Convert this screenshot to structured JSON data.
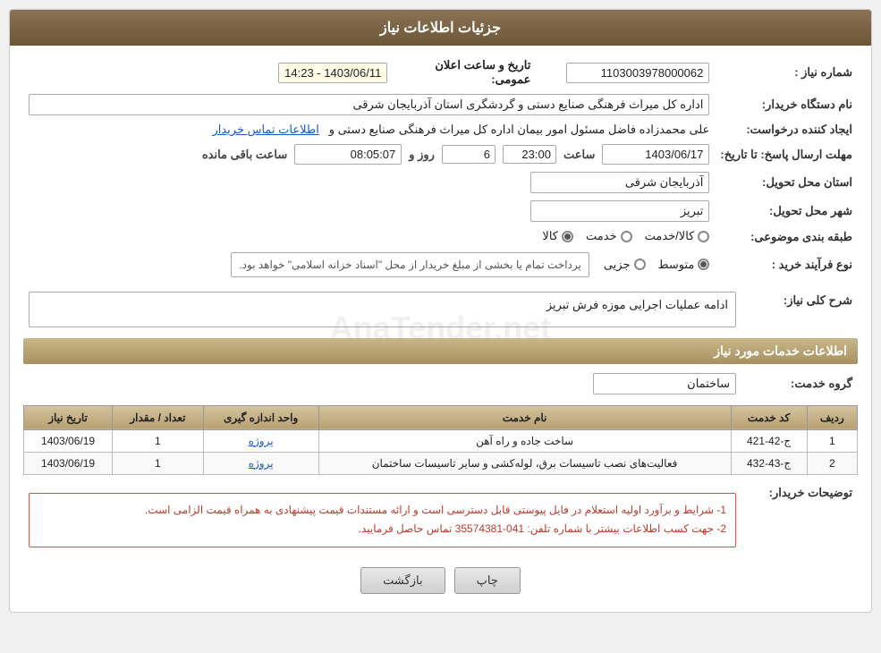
{
  "header": {
    "title": "جزئیات اطلاعات نیاز"
  },
  "fields": {
    "need_number_label": "شماره نیاز :",
    "need_number_value": "1103003978000062",
    "announce_datetime_label": "تاریخ و ساعت اعلان عمومی:",
    "announce_datetime_value": "1403/06/11 - 14:23",
    "buyer_org_label": "نام دستگاه خریدار:",
    "buyer_org_value": "اداره کل میراث فرهنگی  صنایع دستی  و گردشگری استان آذربایجان شرقی",
    "creator_label": "ایجاد کننده درخواست:",
    "creator_value": "علی محمدزاده فاضل مسئول امور بیمان اداره کل میراث فرهنگی  صنایع دستی و",
    "creator_link": "اطلاعات تماس خریدار",
    "deadline_label": "مهلت ارسال پاسخ: تا تاریخ:",
    "deadline_date": "1403/06/17",
    "deadline_time_label": "ساعت",
    "deadline_time": "23:00",
    "deadline_day_label": "روز و",
    "deadline_days": "6",
    "deadline_remaining_label": "ساعت باقی مانده",
    "deadline_remaining": "08:05:07",
    "province_label": "استان محل تحویل:",
    "province_value": "آذربایجان شرقی",
    "city_label": "شهر محل تحویل:",
    "city_value": "تبریز",
    "category_label": "طبقه بندی موضوعی:",
    "category_options": [
      "کالا",
      "خدمت",
      "کالا/خدمت"
    ],
    "category_selected": "کالا",
    "process_label": "نوع فرآیند خرید :",
    "process_options": [
      "جزیی",
      "متوسط"
    ],
    "process_note": "پرداخت تمام یا بخشی از مبلغ خریدار از محل \"اسناد خزانه اسلامی\" خواهد بود.",
    "process_selected": "متوسط"
  },
  "need_description": {
    "section_label": "شرح کلی نیاز:",
    "value": "ادامه عملیات اجرایی موزه فرش تبریز"
  },
  "services_section": {
    "section_label": "اطلاعات خدمات مورد نیاز",
    "service_group_label": "گروه خدمت:",
    "service_group_value": "ساختمان",
    "table": {
      "columns": [
        "ردیف",
        "کد خدمت",
        "نام خدمت",
        "واحد اندازه گیری",
        "تعداد / مقدار",
        "تاریخ نیاز"
      ],
      "rows": [
        {
          "row": "1",
          "code": "ج-42-421",
          "name": "ساخت جاده و راه آهن",
          "unit": "پروژه",
          "qty": "1",
          "date": "1403/06/19"
        },
        {
          "row": "2",
          "code": "ج-43-432",
          "name": "فعالیت‌های نصب تاسیسات برق، لوله‌کشی و سایر تاسیسات ساختمان",
          "unit": "پروژه",
          "qty": "1",
          "date": "1403/06/19"
        }
      ]
    }
  },
  "buyer_description": {
    "label": "توضیحات خریدار:",
    "lines": [
      "1- شرایط و برآورد اولیه استعلام در فایل پیوستی قابل دسترسی است و ارائه مستندات قیمت پیشنهادی به همراه قیمت الزامی است.",
      "2- جهت کسب اطلاعات بیشتر  با شماره تلفن: 041-35574381  تماس حاصل فرمایید."
    ]
  },
  "buttons": {
    "print": "چاپ",
    "back": "بازگشت"
  }
}
